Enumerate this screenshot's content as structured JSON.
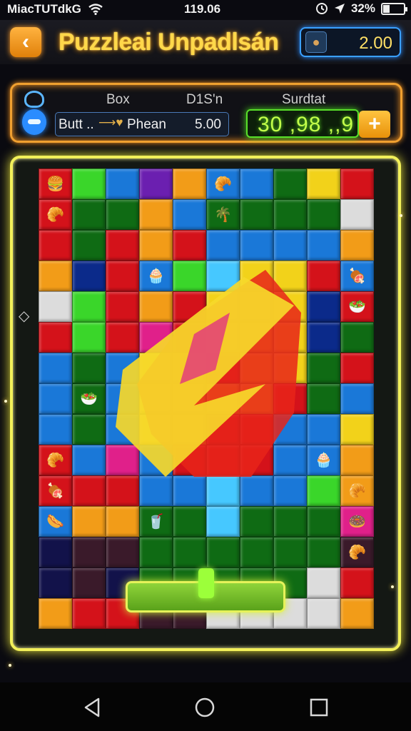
{
  "status": {
    "carrier": "MiacTUTdkG",
    "time": "119.06",
    "battery_label": "32%",
    "battery_level": 0.32
  },
  "header": {
    "back_label": "‹",
    "title": "Puzzleai Unpadlsán",
    "coins": "2.00"
  },
  "info": {
    "head_box": "Box",
    "head_dish": "D1S'n",
    "head_score": "Surdtat",
    "item_name": "Butt ..",
    "item_detail": "Phean",
    "item_value": "5.00",
    "score": "30 ,98 ,,9",
    "add_label": "+"
  },
  "board": {
    "side_marker": "◇",
    "colors": {
      "R": "#d4121a",
      "G": "#0f6b14",
      "L": "#3ad62a",
      "B": "#1a78d8",
      "D": "#0b2a8a",
      "Y": "#f2d21a",
      "O": "#f29c18",
      "P": "#6b1fb0",
      "M": "#e0208a",
      "N": "#12124a",
      "W": "#dcdcdc",
      "K": "#3a1a2a",
      "C": "#46c8ff",
      "E": "#184018"
    },
    "rows": [
      "RLBPOBBGYR",
      "RGGOBGGGGW",
      "RGRORBBBBO",
      "ODRBLCYYRB",
      "WLRORYYYDR",
      "RLRMRYYYDG",
      "BGBYYRYYGR",
      "BGBYYYYRGB",
      "BGBYYRRBBY",
      "RBMBRRRBBO",
      "RRRBBCBBLO",
      "BOOGGCGGGM",
      "NKKGGGGGGK",
      "NKNGGGGGWR",
      "ORRKKWWWWO"
    ],
    "icons": [
      "🍔",
      "🥐",
      "🌴",
      "🍖",
      "🥗",
      "🧁",
      "🍕",
      "🌭",
      "🍩",
      "🥤"
    ]
  }
}
